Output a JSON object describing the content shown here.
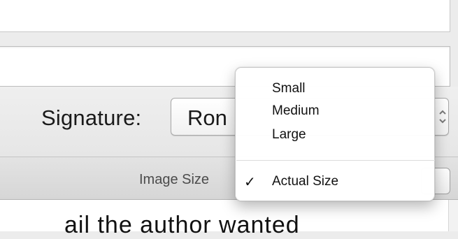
{
  "signature": {
    "label": "Signature:",
    "value": "Ron"
  },
  "image_size": {
    "label": "Image Size"
  },
  "body": {
    "text_fragment": "ail the author wanted"
  },
  "menu": {
    "items": [
      {
        "label": "Small"
      },
      {
        "label": "Medium"
      },
      {
        "label": "Large"
      },
      {
        "label": "Actual Size",
        "checked": true
      }
    ],
    "checkmark": "✓"
  },
  "icons": {
    "stepper": "⌃⌄"
  }
}
